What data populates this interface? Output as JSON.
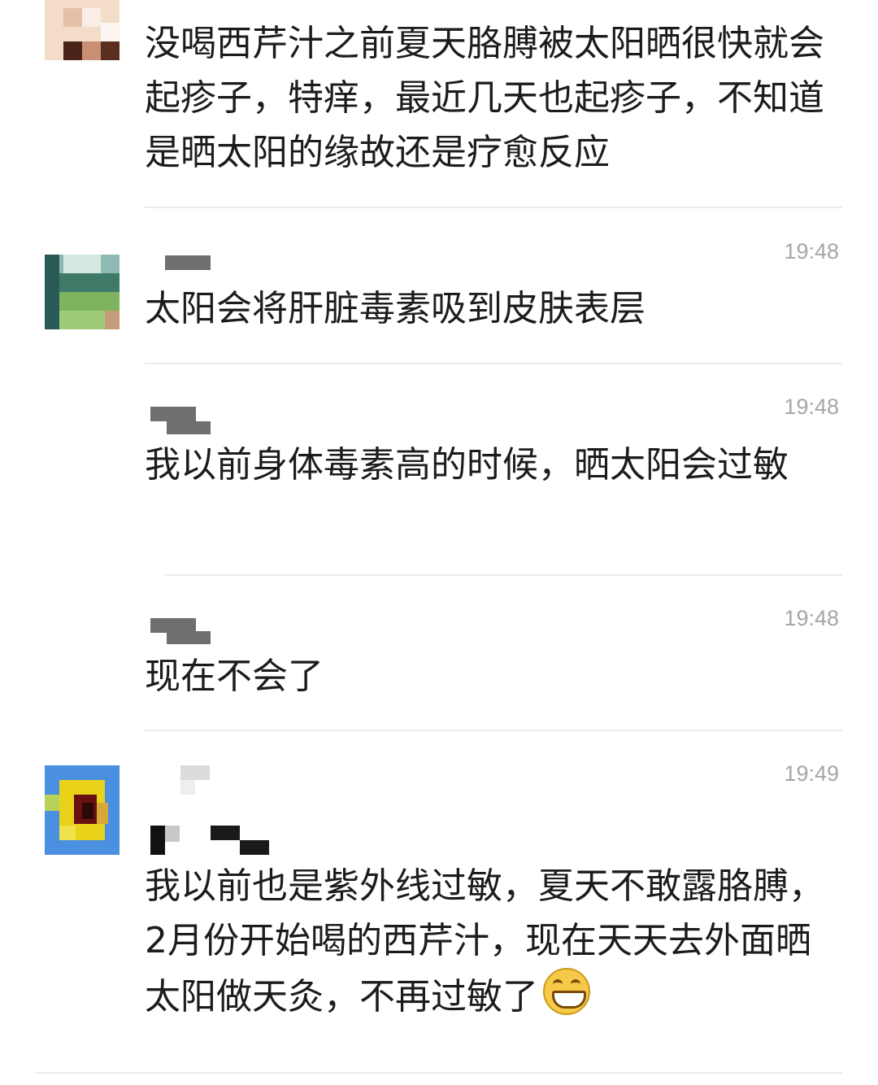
{
  "comments": [
    {
      "text": "没喝西芹汁之前夏天胳膊被太阳晒很快就会起疹子，特痒，最近几天也起疹子，不知道是晒太阳的缘故还是疗愈反应"
    },
    {
      "time": "19:48",
      "text": "太阳会将肝脏毒素吸到皮肤表层"
    },
    {
      "time": "19:48",
      "text": "我以前身体毒素高的时候，晒太阳会过敏"
    },
    {
      "time": "19:48",
      "text": "现在不会了"
    },
    {
      "time": "19:49",
      "text": "我以前也是紫外线过敏，夏天不敢露胳膊，2月份开始喝的西芹汁，现在天天去外面晒太阳做天灸，不再过敏了",
      "emoji": "grinning-face-icon"
    }
  ]
}
